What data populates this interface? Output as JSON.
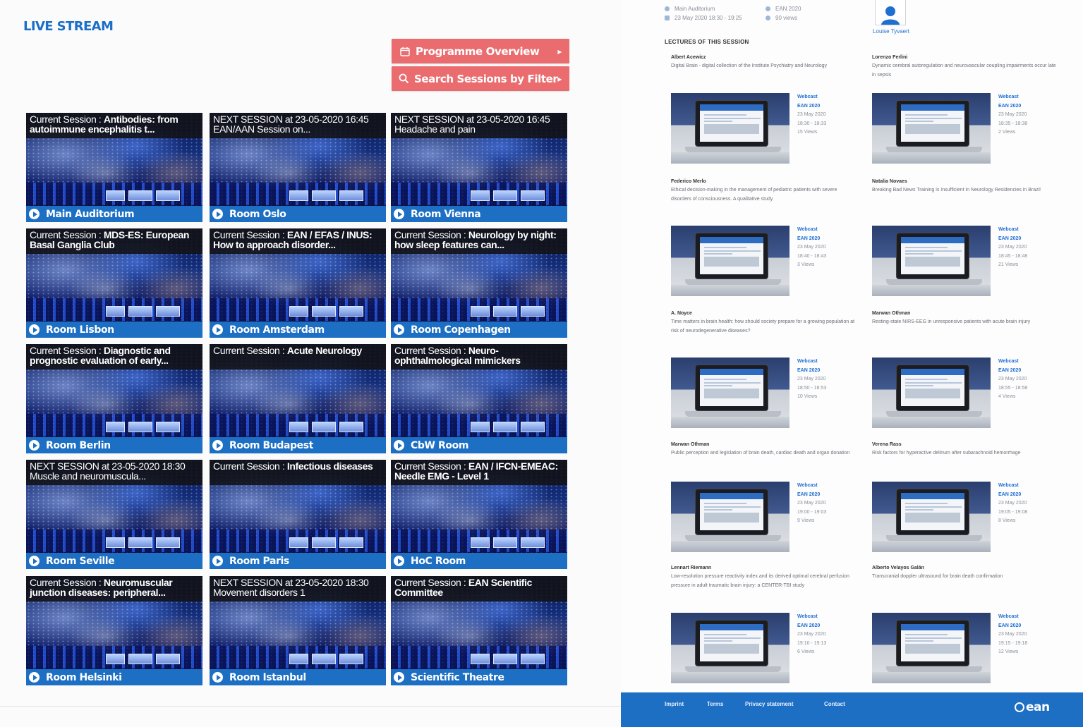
{
  "page_title": "LIVE STREAM",
  "buttons": {
    "programme": "Programme Overview",
    "search": "Search Sessions by Filter"
  },
  "tiles": [
    {
      "prefix": "Current Session : ",
      "title": "Antibodies: from autoimmune encephalitis t...",
      "room": "Main Auditorium"
    },
    {
      "prefix": "NEXT SESSION at 23-05-2020 16:45 EAN/AAN Session on...",
      "title": "",
      "room": "Room Oslo"
    },
    {
      "prefix": "NEXT SESSION at 23-05-2020 16:45 Headache and pain",
      "title": "",
      "room": "Room Vienna"
    },
    {
      "prefix": "Current Session : ",
      "title": "MDS-ES: European Basal Ganglia Club",
      "room": "Room Lisbon"
    },
    {
      "prefix": "Current Session : ",
      "title": "EAN / EFAS / INUS: How to approach disorder...",
      "room": "Room Amsterdam"
    },
    {
      "prefix": "Current Session : ",
      "title": "Neurology by night: how sleep features can...",
      "room": "Room Copenhagen"
    },
    {
      "prefix": "Current Session : ",
      "title": "Diagnostic and prognostic evaluation of early...",
      "room": "Room Berlin"
    },
    {
      "prefix": "Current Session : ",
      "title": "Acute Neurology",
      "room": "Room Budapest"
    },
    {
      "prefix": "Current Session : ",
      "title": "Neuro-ophthalmological mimickers",
      "room": "CbW Room"
    },
    {
      "prefix": "NEXT SESSION at 23-05-2020 18:30 Muscle and neuromuscula...",
      "title": "",
      "room": "Room Seville"
    },
    {
      "prefix": "Current Session : ",
      "title": "Infectious diseases",
      "room": "Room Paris"
    },
    {
      "prefix": "Current Session : ",
      "title": "EAN / IFCN-EMEAC: Needle EMG - Level 1",
      "room": "HoC Room"
    },
    {
      "prefix": "Current Session : ",
      "title": "Neuromuscular junction diseases: peripheral...",
      "room": "Room Helsinki"
    },
    {
      "prefix": "NEXT SESSION at 23-05-2020 18:30 Movement disorders 1",
      "title": "",
      "room": "Room Istanbul"
    },
    {
      "prefix": "Current Session : ",
      "title": "EAN Scientific Committee",
      "room": "Scientific Theatre"
    }
  ],
  "session_meta": {
    "location": "Main Auditorium",
    "date": "23 May 2020 18:30 - 19:25",
    "event": "EAN 2020",
    "views": "90 views",
    "speaker": "Louise Tyvaert"
  },
  "lectures_heading": "LECTURES OF THIS SESSION",
  "lectures": [
    {
      "speaker": "Albert Acewicz",
      "title": "Digital Brain - digital collection of the Institute Psychiatry and Neurology",
      "webcast": "Webcast",
      "event": "EAN 2020",
      "date": "23 May 2020",
      "time": "18:30 - 18:33",
      "views": "15 Views"
    },
    {
      "speaker": "Lorenzo Ferlini",
      "title": "Dynamic cerebral autoregulation and neurovascular coupling impairments occur late in sepsis",
      "webcast": "Webcast",
      "event": "EAN 2020",
      "date": "23 May 2020",
      "time": "18:35 - 18:38",
      "views": "2 Views"
    },
    {
      "speaker": "Federico Merlo",
      "title": "Ethical decision-making in the management of pediatric patients with severe disorders of consciousness. A qualitative study",
      "webcast": "Webcast",
      "event": "EAN 2020",
      "date": "23 May 2020",
      "time": "18:40 - 18:43",
      "views": "3 Views"
    },
    {
      "speaker": "Natalia Novaes",
      "title": "Breaking Bad News Training is Insufficient in Neurology Residencies in Brazil",
      "webcast": "Webcast",
      "event": "EAN 2020",
      "date": "23 May 2020",
      "time": "18:45 - 18:48",
      "views": "21 Views"
    },
    {
      "speaker": "A. Noyce",
      "title": "Time matters in brain health: how should society prepare for a growing population at risk of neurodegenerative diseases?",
      "webcast": "Webcast",
      "event": "EAN 2020",
      "date": "23 May 2020",
      "time": "18:50 - 18:53",
      "views": "10 Views"
    },
    {
      "speaker": "Marwan Othman",
      "title": "Resting-state NIRS-EEG in unresponsive patients with acute brain injury",
      "webcast": "Webcast",
      "event": "EAN 2020",
      "date": "23 May 2020",
      "time": "18:55 - 18:58",
      "views": "4 Views"
    },
    {
      "speaker": "Marwan Othman",
      "title": "Public perception and legislation of brain death, cardiac death and organ donation",
      "webcast": "Webcast",
      "event": "EAN 2020",
      "date": "23 May 2020",
      "time": "19:00 - 19:03",
      "views": "9 Views"
    },
    {
      "speaker": "Verena Rass",
      "title": "Risk factors for hyperactive delirium after subarachnoid hemorrhage",
      "webcast": "Webcast",
      "event": "EAN 2020",
      "date": "23 May 2020",
      "time": "19:05 - 19:08",
      "views": "8 Views"
    },
    {
      "speaker": "Lennart Riemann",
      "title": "Low-resolution pressure reactivity index and its derived optimal cerebral perfusion pressure in adult traumatic brain injury: a CENTER-TBI study",
      "webcast": "Webcast",
      "event": "EAN 2020",
      "date": "23 May 2020",
      "time": "19:10 - 19:13",
      "views": "6 Views"
    },
    {
      "speaker": "Alberto Velayos Galán",
      "title": "Transcranial doppler ultrasound for brain death confirmation",
      "webcast": "Webcast",
      "event": "EAN 2020",
      "date": "23 May 2020",
      "time": "19:15 - 19:18",
      "views": "12 Views"
    }
  ],
  "footer": {
    "links": [
      "Imprint",
      "Terms",
      "Privacy statement",
      "Contact"
    ],
    "logo": "ean"
  },
  "colors": {
    "accent_blue": "#1d6fc4",
    "button_red": "#ea6c6f",
    "title_blue": "#1a6fc6"
  }
}
